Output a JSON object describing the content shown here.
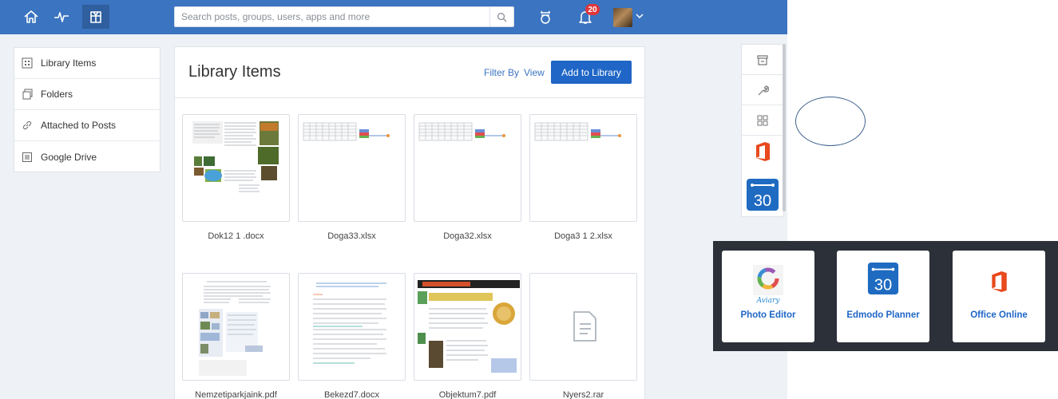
{
  "topbar": {
    "search_placeholder": "Search posts, groups, users, apps and more",
    "notification_count": "20"
  },
  "sidebar": {
    "items": [
      {
        "label": "Library Items",
        "icon": "grid-icon"
      },
      {
        "label": "Folders",
        "icon": "folder-icon"
      },
      {
        "label": "Attached to Posts",
        "icon": "link-icon"
      },
      {
        "label": "Google Drive",
        "icon": "drive-icon"
      }
    ]
  },
  "library": {
    "title": "Library Items",
    "filter_label": "Filter By",
    "view_label": "View",
    "add_button": "Add to Library",
    "items": [
      {
        "name": "Dok12 1 .docx",
        "type": "doc-collage"
      },
      {
        "name": "Doga33.xlsx",
        "type": "spreadsheet"
      },
      {
        "name": "Doga32.xlsx",
        "type": "spreadsheet"
      },
      {
        "name": "Doga3 1 2.xlsx",
        "type": "spreadsheet"
      },
      {
        "name": "Nemzetiparkjaink.pdf",
        "type": "pdf"
      },
      {
        "name": "Bekezd7.docx",
        "type": "doc-text"
      },
      {
        "name": "Objektum7.pdf",
        "type": "pdf-colorful"
      },
      {
        "name": "Nyers2.rar",
        "type": "generic-file"
      }
    ]
  },
  "right_column": {
    "icons": [
      "store-icon",
      "wrench-icon",
      "apps-grid-icon",
      "office-icon",
      "planner-icon"
    ],
    "planner_day": "30"
  },
  "apps_popup": {
    "tiles": [
      {
        "label": "Photo Editor",
        "sublabel": "Aviary"
      },
      {
        "label": "Edmodo Planner",
        "day": "30"
      },
      {
        "label": "Office Online"
      }
    ]
  },
  "colors": {
    "topbar": "#3b74c0",
    "accent": "#1f66c6",
    "badge": "#e2353b",
    "office": "#e8491d"
  }
}
